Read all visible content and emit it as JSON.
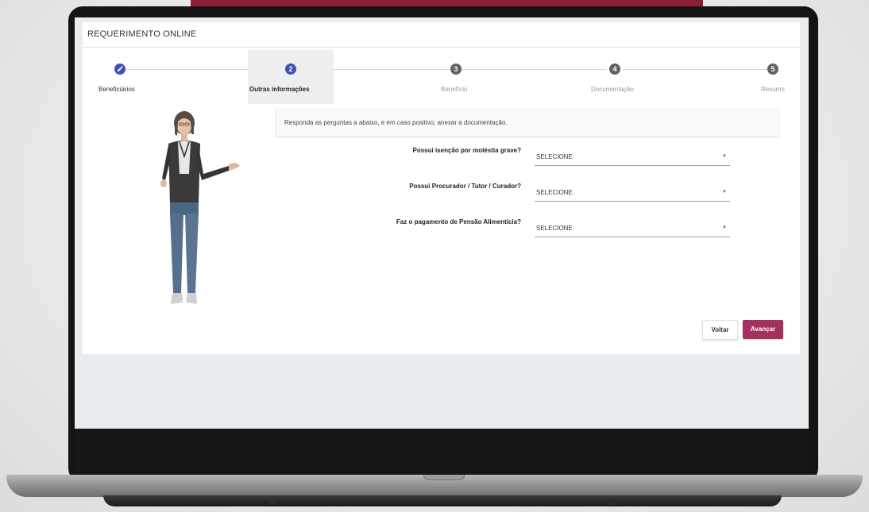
{
  "app": {
    "title": "REQUERIMENTO ONLINE"
  },
  "stepper": {
    "steps": [
      {
        "number": "",
        "label": "Beneficiários",
        "state": "completed"
      },
      {
        "number": "2",
        "label": "Outras informações",
        "state": "active"
      },
      {
        "number": "3",
        "label": "Benefício",
        "state": "pending"
      },
      {
        "number": "4",
        "label": "Documentação",
        "state": "pending"
      },
      {
        "number": "5",
        "label": "Resumo",
        "state": "pending"
      }
    ]
  },
  "info": {
    "text": "Responda as perguntas a abaixo, e em caso positivo, anexar a documentação."
  },
  "questions": [
    {
      "label": "Possui isenção por moléstia grave?",
      "value": "SELECIONE"
    },
    {
      "label": "Possui Procurador / Tutor / Curador?",
      "value": "SELECIONE"
    },
    {
      "label": "Faz o pagamento de Pensão Alimentícia?",
      "value": "SELECIONE"
    }
  ],
  "actions": {
    "back_label": "Voltar",
    "next_label": "Avançar"
  },
  "colors": {
    "primary": "#3f51b5",
    "accent": "#a3305e",
    "pending_step": "#616161",
    "brand_top": "#8a1e3a"
  },
  "icons": {
    "completed_step": "pencil-icon",
    "select_caret": "caret-down-icon"
  }
}
